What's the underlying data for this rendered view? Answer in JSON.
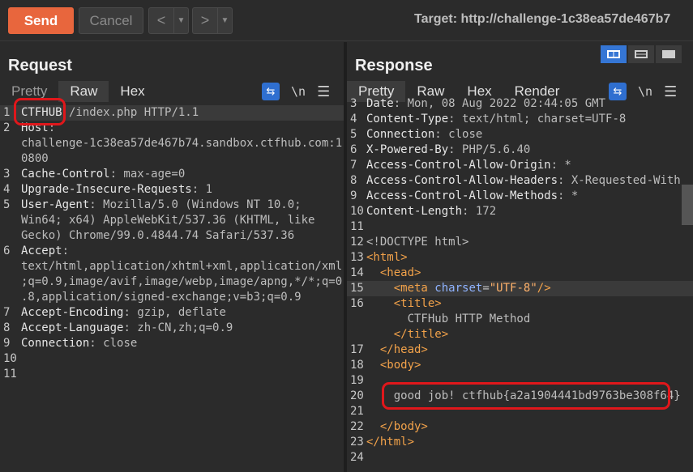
{
  "toolbar": {
    "send_label": "Send",
    "cancel_label": "Cancel",
    "back_glyph": "<",
    "forward_glyph": ">",
    "drop_glyph": "▼",
    "target": "Target: http://challenge-1c38ea57de467b7"
  },
  "request": {
    "title": "Request",
    "tabs": [
      "Pretty",
      "Raw",
      "Hex"
    ],
    "active_tab": "Raw",
    "lines": [
      {
        "n": "1",
        "parts": [
          [
            "m",
            "CTFHUB"
          ],
          [
            "v",
            " /index.php HTTP/1.1"
          ]
        ]
      },
      {
        "n": "2",
        "parts": [
          [
            "k",
            "Host"
          ],
          [
            "v",
            ":"
          ]
        ]
      },
      {
        "n": "",
        "parts": [
          [
            "v",
            "challenge-1c38ea57de467b74.sandbox.ctfhub.com:1"
          ]
        ]
      },
      {
        "n": "",
        "parts": [
          [
            "v",
            "0800"
          ]
        ]
      },
      {
        "n": "3",
        "parts": [
          [
            "k",
            "Cache-Control"
          ],
          [
            "v",
            ": max-age=0"
          ]
        ]
      },
      {
        "n": "4",
        "parts": [
          [
            "k",
            "Upgrade-Insecure-Requests"
          ],
          [
            "v",
            ": 1"
          ]
        ]
      },
      {
        "n": "5",
        "parts": [
          [
            "k",
            "User-Agent"
          ],
          [
            "v",
            ": Mozilla/5.0 (Windows NT 10.0;"
          ]
        ]
      },
      {
        "n": "",
        "parts": [
          [
            "v",
            "Win64; x64) AppleWebKit/537.36 (KHTML, like"
          ]
        ]
      },
      {
        "n": "",
        "parts": [
          [
            "v",
            "Gecko) Chrome/99.0.4844.74 Safari/537.36"
          ]
        ]
      },
      {
        "n": "6",
        "parts": [
          [
            "k",
            "Accept"
          ],
          [
            "v",
            ":"
          ]
        ]
      },
      {
        "n": "",
        "parts": [
          [
            "v",
            "text/html,application/xhtml+xml,application/xml"
          ]
        ]
      },
      {
        "n": "",
        "parts": [
          [
            "v",
            ";q=0.9,image/avif,image/webp,image/apng,*/*;q=0"
          ]
        ]
      },
      {
        "n": "",
        "parts": [
          [
            "v",
            ".8,application/signed-exchange;v=b3;q=0.9"
          ]
        ]
      },
      {
        "n": "7",
        "parts": [
          [
            "k",
            "Accept-Encoding"
          ],
          [
            "v",
            ": gzip, deflate"
          ]
        ]
      },
      {
        "n": "8",
        "parts": [
          [
            "k",
            "Accept-Language"
          ],
          [
            "v",
            ": zh-CN,zh;q=0.9"
          ]
        ]
      },
      {
        "n": "9",
        "parts": [
          [
            "k",
            "Connection"
          ],
          [
            "v",
            ": close"
          ]
        ]
      },
      {
        "n": "10",
        "parts": []
      },
      {
        "n": "11",
        "parts": []
      }
    ]
  },
  "response": {
    "title": "Response",
    "tabs": [
      "Pretty",
      "Raw",
      "Hex",
      "Render"
    ],
    "active_tab": "Pretty",
    "lines": [
      {
        "n": "3",
        "parts": [
          [
            "k",
            "Date"
          ],
          [
            "v",
            ": Mon, 08 Aug 2022 02:44:05 GMT"
          ]
        ]
      },
      {
        "n": "4",
        "parts": [
          [
            "k",
            "Content-Type"
          ],
          [
            "v",
            ": text/html; charset=UTF-8"
          ]
        ]
      },
      {
        "n": "5",
        "parts": [
          [
            "k",
            "Connection"
          ],
          [
            "v",
            ": close"
          ]
        ]
      },
      {
        "n": "6",
        "parts": [
          [
            "k",
            "X-Powered-By"
          ],
          [
            "v",
            ": PHP/5.6.40"
          ]
        ]
      },
      {
        "n": "7",
        "parts": [
          [
            "k",
            "Access-Control-Allow-Origin"
          ],
          [
            "v",
            ": *"
          ]
        ]
      },
      {
        "n": "8",
        "parts": [
          [
            "k",
            "Access-Control-Allow-Headers"
          ],
          [
            "v",
            ": X-Requested-With"
          ]
        ]
      },
      {
        "n": "9",
        "parts": [
          [
            "k",
            "Access-Control-Allow-Methods"
          ],
          [
            "v",
            ": *"
          ]
        ]
      },
      {
        "n": "10",
        "parts": [
          [
            "k",
            "Content-Length"
          ],
          [
            "v",
            ": 172"
          ]
        ]
      },
      {
        "n": "11",
        "parts": []
      },
      {
        "n": "12",
        "parts": [
          [
            "v",
            "<!DOCTYPE html>"
          ]
        ]
      },
      {
        "n": "13",
        "parts": [
          [
            "tag",
            "<html>"
          ]
        ]
      },
      {
        "n": "14",
        "parts": [
          [
            "v",
            "  "
          ],
          [
            "tag",
            "<head>"
          ]
        ]
      },
      {
        "n": "15",
        "parts": [
          [
            "v",
            "    "
          ],
          [
            "tag",
            "<meta "
          ],
          [
            "attr",
            "charset"
          ],
          [
            "v",
            "="
          ],
          [
            "str",
            "\"UTF-8\""
          ],
          [
            "tag",
            "/>"
          ]
        ]
      },
      {
        "n": "16",
        "parts": [
          [
            "v",
            "    "
          ],
          [
            "tag",
            "<title>"
          ]
        ]
      },
      {
        "n": "",
        "parts": [
          [
            "v",
            "      CTFHub HTTP Method"
          ]
        ]
      },
      {
        "n": "",
        "parts": [
          [
            "v",
            "    "
          ],
          [
            "tag",
            "</title>"
          ]
        ]
      },
      {
        "n": "17",
        "parts": [
          [
            "v",
            "  "
          ],
          [
            "tag",
            "</head>"
          ]
        ]
      },
      {
        "n": "18",
        "parts": [
          [
            "v",
            "  "
          ],
          [
            "tag",
            "<body>"
          ]
        ]
      },
      {
        "n": "19",
        "parts": []
      },
      {
        "n": "20",
        "parts": [
          [
            "v",
            "    good job! ctfhub{a2a1904441bd9763be308f64}"
          ]
        ]
      },
      {
        "n": "21",
        "parts": []
      },
      {
        "n": "22",
        "parts": [
          [
            "v",
            "  "
          ],
          [
            "tag",
            "</body>"
          ]
        ]
      },
      {
        "n": "23",
        "parts": [
          [
            "tag",
            "</html>"
          ]
        ]
      },
      {
        "n": "24",
        "parts": []
      }
    ]
  },
  "icons": {
    "wrap": "⇆",
    "newline": "\\n",
    "menu": "☰"
  },
  "colors": {
    "send": "#e8663d",
    "annotation_box": "#e0171b",
    "layout_active": "#3576d5",
    "tag": "#f2a24a"
  }
}
